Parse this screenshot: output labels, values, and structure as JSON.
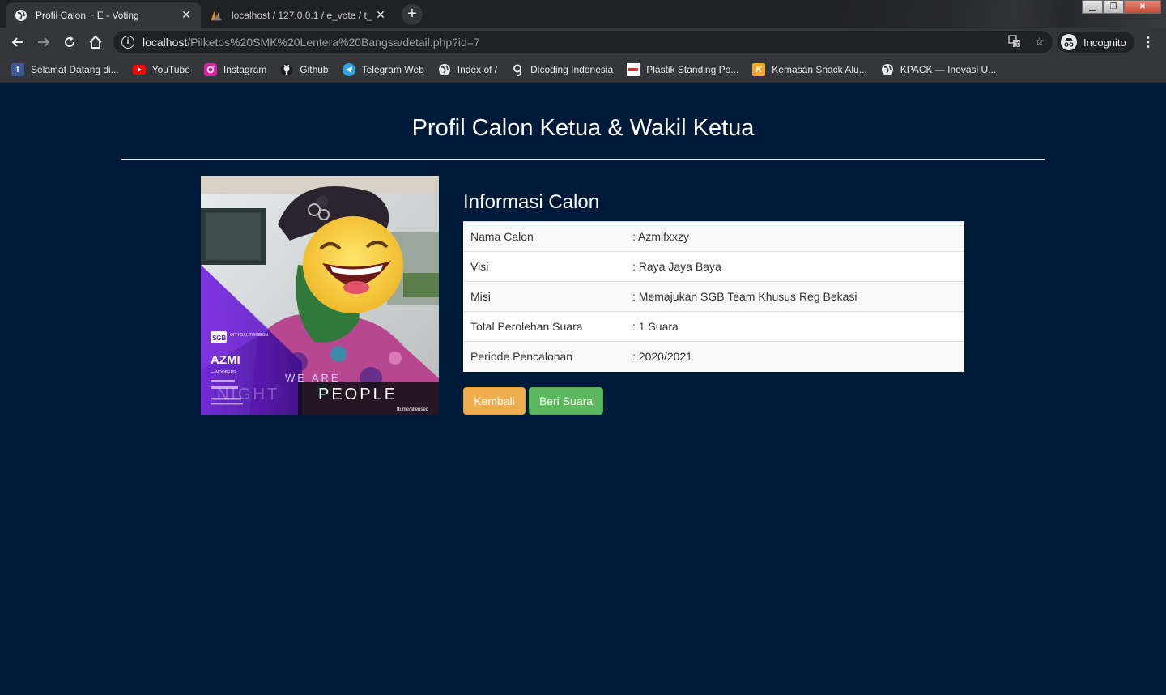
{
  "browser": {
    "tabs": [
      {
        "title": "Profil Calon ~ E - Voting",
        "active": true
      },
      {
        "title": "localhost / 127.0.0.1 / e_vote / t_",
        "active": false
      }
    ],
    "url_host": "localhost",
    "url_path": "/Pilketos%20SMK%20Lentera%20Bangsa/detail.php?id=7",
    "profile_label": "Incognito",
    "bookmarks": [
      {
        "label": "Selamat Datang di...",
        "icon": "facebook-icon",
        "color": "#3b5998"
      },
      {
        "label": "YouTube",
        "icon": "youtube-icon",
        "color": "#ff0000"
      },
      {
        "label": "Instagram",
        "icon": "instagram-icon",
        "color": "#e1306c"
      },
      {
        "label": "Github",
        "icon": "github-icon",
        "color": "#ffffff"
      },
      {
        "label": "Telegram Web",
        "icon": "telegram-icon",
        "color": "#2ca5e0"
      },
      {
        "label": "Index of /",
        "icon": "globe-icon",
        "color": "#e8eaed"
      },
      {
        "label": "Dicoding Indonesia",
        "icon": "dicoding-icon",
        "color": "#e8eaed"
      },
      {
        "label": "Plastik Standing Po...",
        "icon": "plastik-icon",
        "color": "#d32f2f"
      },
      {
        "label": "Kemasan Snack Alu...",
        "icon": "kemasan-icon",
        "color": "#f5a623"
      },
      {
        "label": "KPACK — Inovasi U...",
        "icon": "globe-icon",
        "color": "#e8eaed"
      }
    ]
  },
  "page": {
    "title": "Profil Calon Ketua & Wakil Ketua",
    "info_title": "Informasi Calon",
    "rows": [
      {
        "label": "Nama Calon",
        "value": ": Azmifxxzy"
      },
      {
        "label": "Visi",
        "value": ": Raya Jaya Baya"
      },
      {
        "label": "Misi",
        "value": ": Memajukan SGB Team Khusus Reg Bekasi"
      },
      {
        "label": "Total Perolehan Suara",
        "value": ": 1 Suara"
      },
      {
        "label": "Periode Pencalonan",
        "value": ": 2020/2021"
      }
    ],
    "buttons": {
      "back": "Kembali",
      "vote": "Beri Suara"
    },
    "photo": {
      "name_text": "AZMI",
      "sub_text": "— NOOBERS",
      "badge_text": "SGB",
      "badge_sub": "OFFICIAL TWIBBON",
      "tagline_1": "WE ARE",
      "tagline_2_faint": "NIGHT",
      "tagline_2": "PEOPLE",
      "credit": "fb.me/aliensec"
    }
  }
}
